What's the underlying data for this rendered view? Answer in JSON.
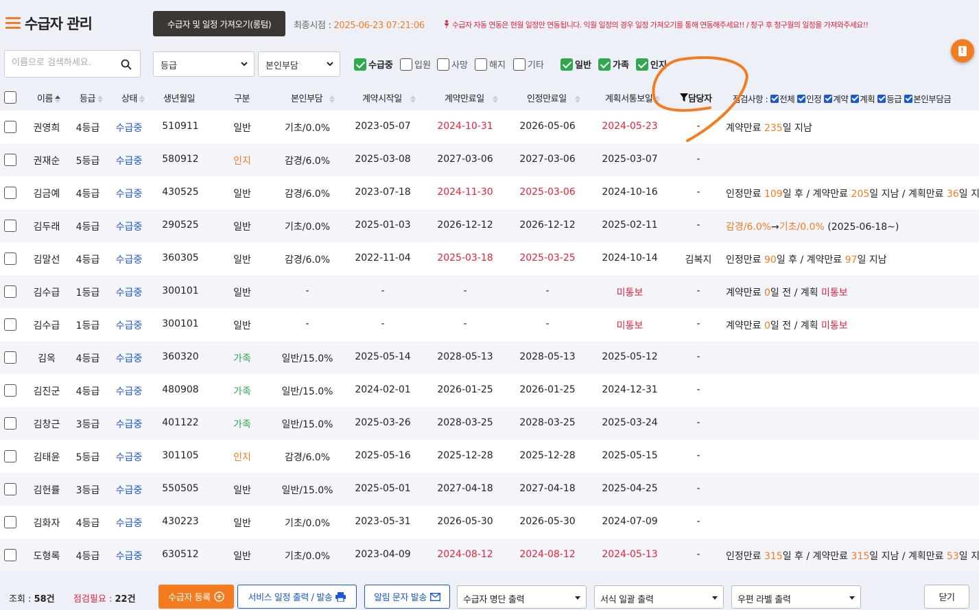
{
  "header": {
    "title": "수급자 관리",
    "import_button": "수급자 및 일정 가져오기(롱텀)",
    "last_sync_label": "최종시점 : ",
    "last_sync_value": "2025-06-23 07:21:06",
    "notice": "수급자 자동 연동은 현월 일정만 연동됩니다. 익월 일정의 경우 일정 가져오기를 통해 연동해주세요!! / 청구 후 청구월의 일정을 가져와주세요!!"
  },
  "filters": {
    "search_placeholder": "이름으로 검색하세요.",
    "grade_select": "등급",
    "copay_select": "본인부담",
    "checkboxes": [
      {
        "label": "수급중",
        "checked": true
      },
      {
        "label": "입원",
        "checked": false
      },
      {
        "label": "사망",
        "checked": false
      },
      {
        "label": "해지",
        "checked": false
      },
      {
        "label": "기타",
        "checked": false
      },
      {
        "label": "일반",
        "checked": true
      },
      {
        "label": "가족",
        "checked": true
      },
      {
        "label": "인지",
        "checked": true
      }
    ]
  },
  "table": {
    "headers": {
      "name": "이름",
      "grade": "등급",
      "status": "상태",
      "birth": "생년월일",
      "type": "구분",
      "copay": "본인부담",
      "contract_start": "계약시작일",
      "contract_end": "계약만료일",
      "cert_end": "인정만료일",
      "plan_notice": "계획서통보일",
      "manager": "담당자",
      "inspect_label": "점검사항 :"
    },
    "inspect_options": [
      "전체",
      "인정",
      "계약",
      "계획",
      "등급",
      "본인부담금"
    ],
    "rows": [
      {
        "name": "권영희",
        "grade": "4등급",
        "status": "수급중",
        "birth": "510911",
        "type": "일반",
        "type_color": "",
        "copay": "기초/0.0%",
        "cstart": "2023-05-07",
        "cend": "2024-10-31",
        "cend_red": true,
        "cert": "2026-05-06",
        "cert_red": false,
        "plan": "2024-05-23",
        "plan_red": true,
        "mgr": "-",
        "note": [
          [
            "계약만료 ",
            ""
          ],
          [
            "235",
            "o"
          ],
          [
            "일 지남",
            ""
          ]
        ]
      },
      {
        "name": "권재순",
        "grade": "5등급",
        "status": "수급중",
        "birth": "580912",
        "type": "인지",
        "type_color": "orange",
        "copay": "감경/6.0%",
        "cstart": "2025-03-08",
        "cend": "2027-03-06",
        "cend_red": false,
        "cert": "2027-03-06",
        "cert_red": false,
        "plan": "2025-03-07",
        "plan_red": false,
        "mgr": "-",
        "note": []
      },
      {
        "name": "김금예",
        "grade": "4등급",
        "status": "수급중",
        "birth": "430525",
        "type": "일반",
        "type_color": "",
        "copay": "감경/6.0%",
        "cstart": "2023-07-18",
        "cend": "2024-11-30",
        "cend_red": true,
        "cert": "2025-03-06",
        "cert_red": true,
        "plan": "2024-10-16",
        "plan_red": false,
        "mgr": "-",
        "note": [
          [
            "인정만료 ",
            ""
          ],
          [
            "109",
            "o"
          ],
          [
            "일 후 / 계약만료 ",
            ""
          ],
          [
            "205",
            "o"
          ],
          [
            "일 지남 / 계획만료 ",
            ""
          ],
          [
            "36",
            "o"
          ],
          [
            "일 지남",
            ""
          ]
        ]
      },
      {
        "name": "김두래",
        "grade": "4등급",
        "status": "수급중",
        "birth": "290525",
        "type": "일반",
        "type_color": "",
        "copay": "기초/0.0%",
        "cstart": "2025-01-03",
        "cend": "2026-12-12",
        "cend_red": false,
        "cert": "2026-12-12",
        "cert_red": false,
        "plan": "2025-02-11",
        "plan_red": false,
        "mgr": "-",
        "note": [
          [
            "감경/6.0%",
            "o"
          ],
          [
            "→",
            ""
          ],
          [
            "기초/0.0%",
            "o"
          ],
          [
            " (2025-06-18~)",
            ""
          ]
        ]
      },
      {
        "name": "김말선",
        "grade": "4등급",
        "status": "수급중",
        "birth": "360305",
        "type": "일반",
        "type_color": "",
        "copay": "감경/6.0%",
        "cstart": "2022-11-04",
        "cend": "2025-03-18",
        "cend_red": true,
        "cert": "2025-03-25",
        "cert_red": true,
        "plan": "2024-10-14",
        "plan_red": false,
        "mgr": "김복지",
        "note": [
          [
            "인정만료 ",
            ""
          ],
          [
            "90",
            "o"
          ],
          [
            "일 후 / 계약만료 ",
            ""
          ],
          [
            "97",
            "o"
          ],
          [
            "일 지남",
            ""
          ]
        ]
      },
      {
        "name": "김수급",
        "grade": "1등급",
        "status": "수급중",
        "birth": "300101",
        "type": "일반",
        "type_color": "",
        "copay": "-",
        "cstart": "-",
        "cend": "-",
        "cend_red": false,
        "cert": "-",
        "cert_red": false,
        "plan": "미통보",
        "plan_red": true,
        "mgr": "-",
        "note": [
          [
            "계약만료 ",
            ""
          ],
          [
            "0",
            "o"
          ],
          [
            "일 전 / 계획 ",
            ""
          ],
          [
            "미통보",
            "r"
          ]
        ]
      },
      {
        "name": "김수급",
        "grade": "1등급",
        "status": "수급중",
        "birth": "300101",
        "type": "일반",
        "type_color": "",
        "copay": "-",
        "cstart": "-",
        "cend": "-",
        "cend_red": false,
        "cert": "-",
        "cert_red": false,
        "plan": "미통보",
        "plan_red": true,
        "mgr": "-",
        "note": [
          [
            "계약만료 ",
            ""
          ],
          [
            "0",
            "o"
          ],
          [
            "일 전 / 계획 ",
            ""
          ],
          [
            "미통보",
            "r"
          ]
        ]
      },
      {
        "name": "김옥",
        "grade": "4등급",
        "status": "수급중",
        "birth": "360320",
        "type": "가족",
        "type_color": "green",
        "copay": "일반/15.0%",
        "cstart": "2025-05-14",
        "cend": "2028-05-13",
        "cend_red": false,
        "cert": "2028-05-13",
        "cert_red": false,
        "plan": "2025-05-12",
        "plan_red": false,
        "mgr": "-",
        "note": []
      },
      {
        "name": "김진군",
        "grade": "4등급",
        "status": "수급중",
        "birth": "480908",
        "type": "가족",
        "type_color": "green",
        "copay": "일반/15.0%",
        "cstart": "2024-02-01",
        "cend": "2026-01-25",
        "cend_red": false,
        "cert": "2026-01-25",
        "cert_red": false,
        "plan": "2024-12-31",
        "plan_red": false,
        "mgr": "-",
        "note": []
      },
      {
        "name": "김창근",
        "grade": "3등급",
        "status": "수급중",
        "birth": "401122",
        "type": "가족",
        "type_color": "green",
        "copay": "일반/15.0%",
        "cstart": "2025-03-26",
        "cend": "2028-03-25",
        "cend_red": false,
        "cert": "2028-03-25",
        "cert_red": false,
        "plan": "2025-03-24",
        "plan_red": false,
        "mgr": "-",
        "note": []
      },
      {
        "name": "김태윤",
        "grade": "5등급",
        "status": "수급중",
        "birth": "301105",
        "type": "인지",
        "type_color": "orange",
        "copay": "감경/6.0%",
        "cstart": "2025-05-16",
        "cend": "2025-12-28",
        "cend_red": false,
        "cert": "2025-12-28",
        "cert_red": false,
        "plan": "2025-05-15",
        "plan_red": false,
        "mgr": "-",
        "note": []
      },
      {
        "name": "김헌률",
        "grade": "3등급",
        "status": "수급중",
        "birth": "550505",
        "type": "일반",
        "type_color": "",
        "copay": "일반/15.0%",
        "cstart": "2025-05-01",
        "cend": "2027-04-18",
        "cend_red": false,
        "cert": "2027-04-18",
        "cert_red": false,
        "plan": "2025-04-25",
        "plan_red": false,
        "mgr": "-",
        "note": []
      },
      {
        "name": "김화자",
        "grade": "4등급",
        "status": "수급중",
        "birth": "430223",
        "type": "일반",
        "type_color": "",
        "copay": "기초/0.0%",
        "cstart": "2023-05-31",
        "cend": "2026-05-30",
        "cend_red": false,
        "cert": "2026-05-30",
        "cert_red": false,
        "plan": "2024-07-09",
        "plan_red": false,
        "mgr": "-",
        "note": []
      },
      {
        "name": "도형록",
        "grade": "4등급",
        "status": "수급중",
        "birth": "630512",
        "type": "일반",
        "type_color": "",
        "copay": "기초/0.0%",
        "cstart": "2023-04-09",
        "cend": "2024-08-12",
        "cend_red": true,
        "cert": "2024-08-12",
        "cert_red": true,
        "plan": "2024-05-13",
        "plan_red": true,
        "mgr": "-",
        "note": [
          [
            "인정만료 ",
            ""
          ],
          [
            "315",
            "o"
          ],
          [
            "일 후 / 계약만료 ",
            ""
          ],
          [
            "315",
            "o"
          ],
          [
            "일 지남 / 계획만료 ",
            ""
          ],
          [
            "53",
            "o"
          ],
          [
            "일 지남",
            ""
          ]
        ]
      }
    ]
  },
  "footer": {
    "count_label": "조회 : ",
    "count_value": "58건",
    "need_label": "점검필요 : ",
    "need_value": "22건",
    "register_btn": "수급자 등록",
    "service_print_btn": "서비스 일정 출력 / 발송",
    "sms_btn": "알림 문자 발송",
    "roster_select": "수급자 명단 출력",
    "form_select": "서식 일괄 출력",
    "label_select": "우편 라벨 출력",
    "close_btn": "닫기"
  },
  "colors": {
    "accent": "#f47c20",
    "red": "#e0243b",
    "green": "#2fa84f",
    "blue": "#1a56d6",
    "dark_button": "#3b3833"
  }
}
